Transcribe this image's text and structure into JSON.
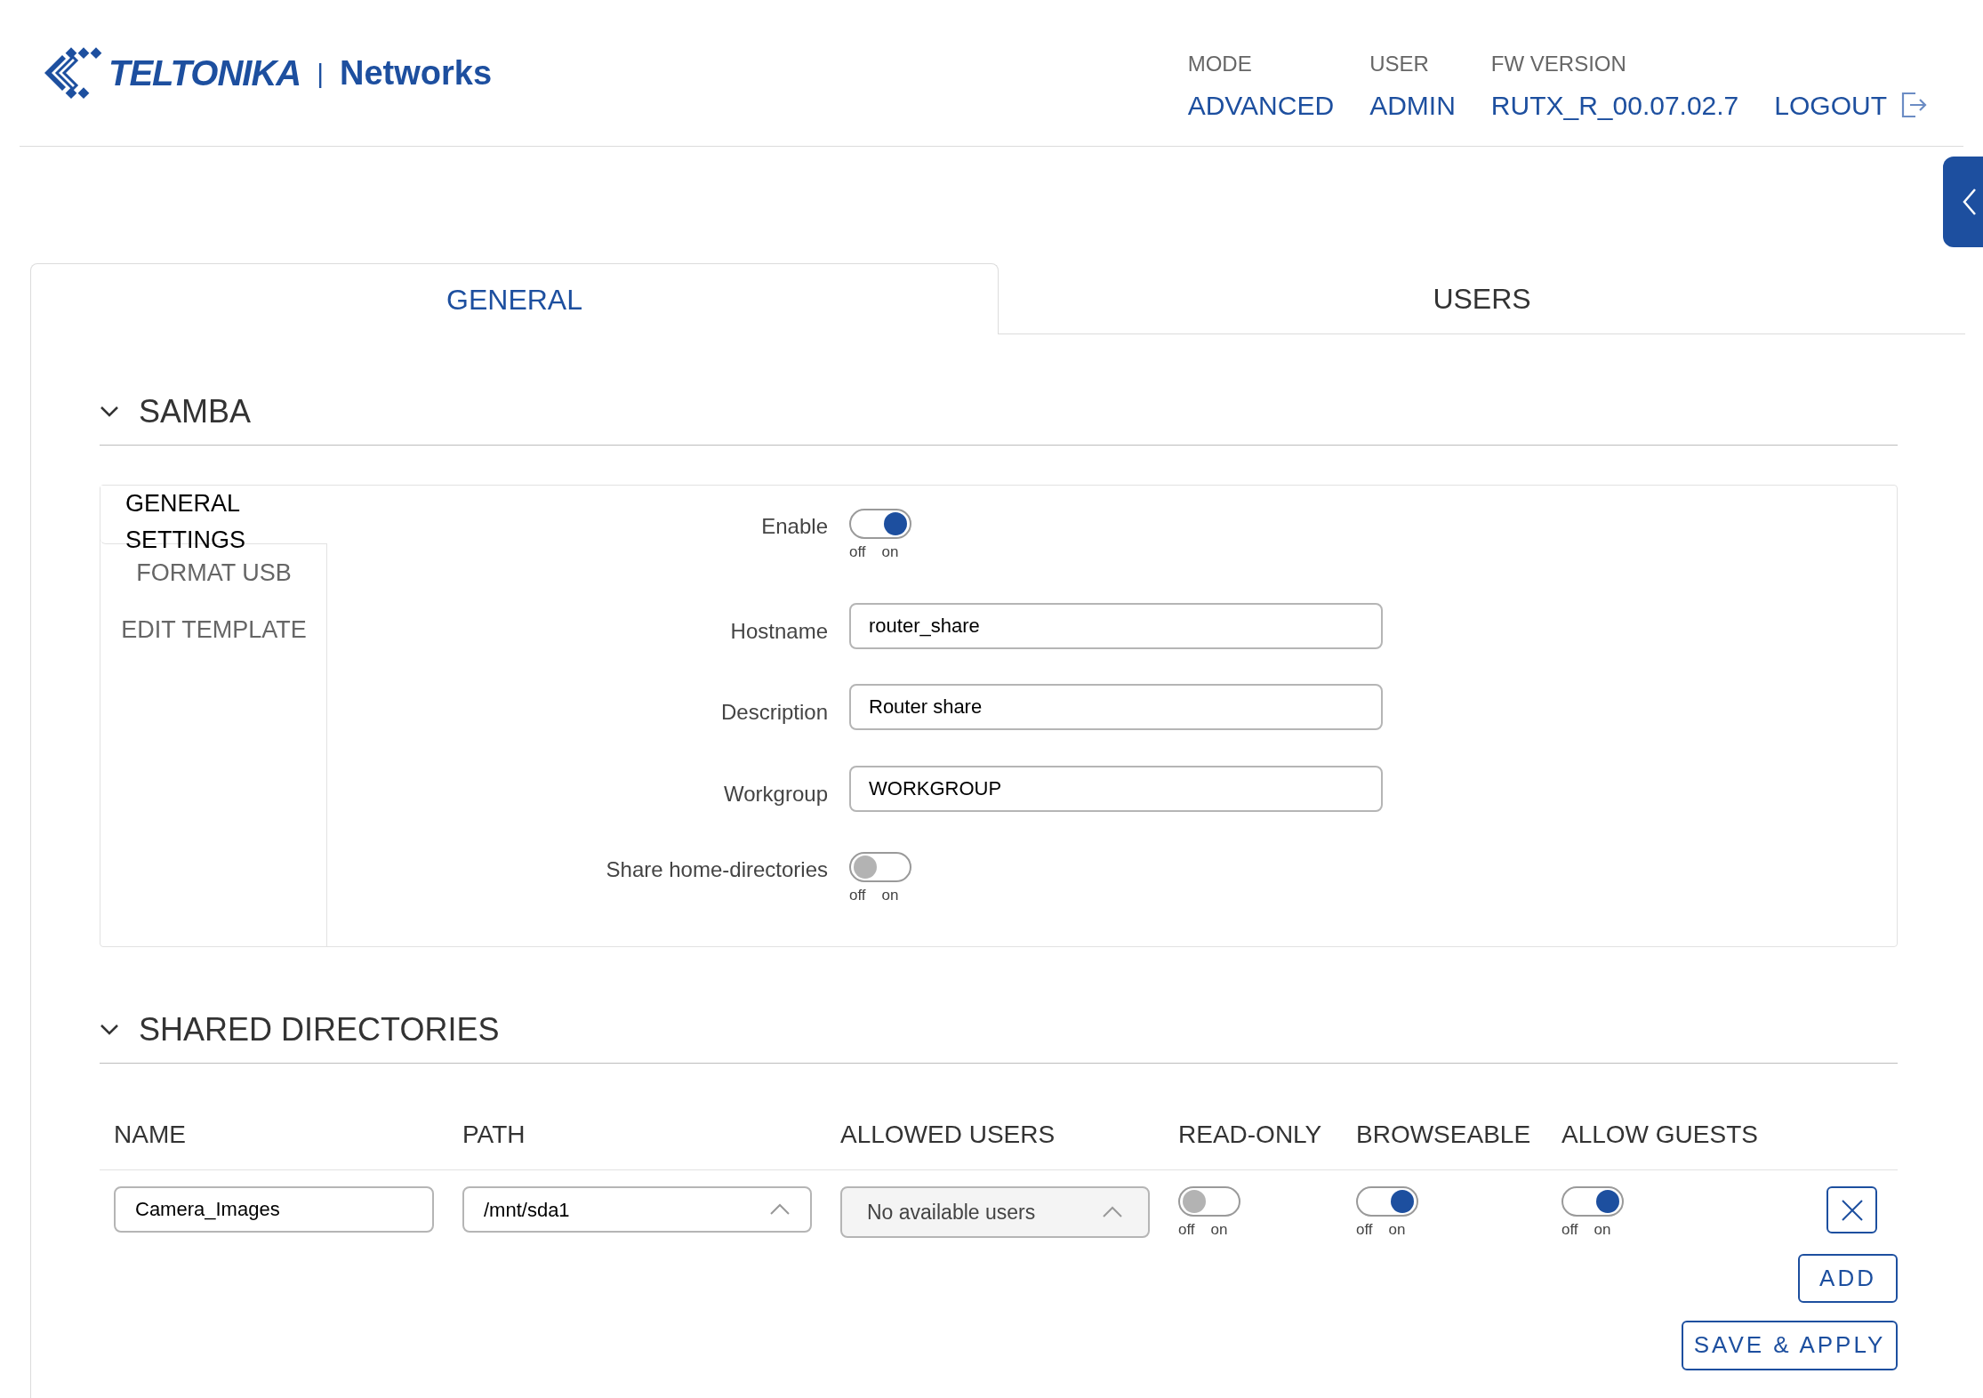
{
  "header": {
    "logo": {
      "brand": "TELTONIKA",
      "separator": "|",
      "sub": "Networks"
    },
    "info": [
      {
        "label": "MODE",
        "value": "ADVANCED"
      },
      {
        "label": "USER",
        "value": "ADMIN"
      },
      {
        "label": "FW VERSION",
        "value": "RUTX_R_00.07.02.7"
      }
    ],
    "logout": "LOGOUT"
  },
  "tabs": [
    {
      "label": "GENERAL",
      "selected": true
    },
    {
      "label": "USERS",
      "selected": false
    }
  ],
  "samba": {
    "title": "SAMBA",
    "expanded": true,
    "sidebar": [
      {
        "label": "GENERAL SETTINGS",
        "selected": true
      },
      {
        "label": "FORMAT USB",
        "selected": false
      },
      {
        "label": "EDIT TEMPLATE",
        "selected": false
      }
    ],
    "fields": [
      {
        "kind": "toggle",
        "label": "Enable",
        "on": true,
        "off_label": "off",
        "on_label": "on"
      },
      {
        "kind": "text",
        "label": "Hostname",
        "value": "router_share"
      },
      {
        "kind": "text",
        "label": "Description",
        "value": "Router share"
      },
      {
        "kind": "text",
        "label": "Workgroup",
        "value": "WORKGROUP"
      },
      {
        "kind": "toggle",
        "label": "Share home-directories",
        "on": false,
        "off_label": "off",
        "on_label": "on"
      }
    ]
  },
  "shared_directories": {
    "title": "SHARED DIRECTORIES",
    "expanded": true,
    "columns": [
      "NAME",
      "PATH",
      "ALLOWED USERS",
      "READ-ONLY",
      "BROWSEABLE",
      "ALLOW GUESTS"
    ],
    "rows": [
      {
        "name": "Camera_Images",
        "path": "/mnt/sda1",
        "allowed_users": "No available users",
        "toggles": [
          {
            "on": false,
            "off_label": "off",
            "on_label": "on"
          },
          {
            "on": true,
            "off_label": "off",
            "on_label": "on"
          },
          {
            "on": true,
            "off_label": "off",
            "on_label": "on"
          }
        ]
      }
    ],
    "add_button": "ADD",
    "save_button": "SAVE & APPLY"
  }
}
